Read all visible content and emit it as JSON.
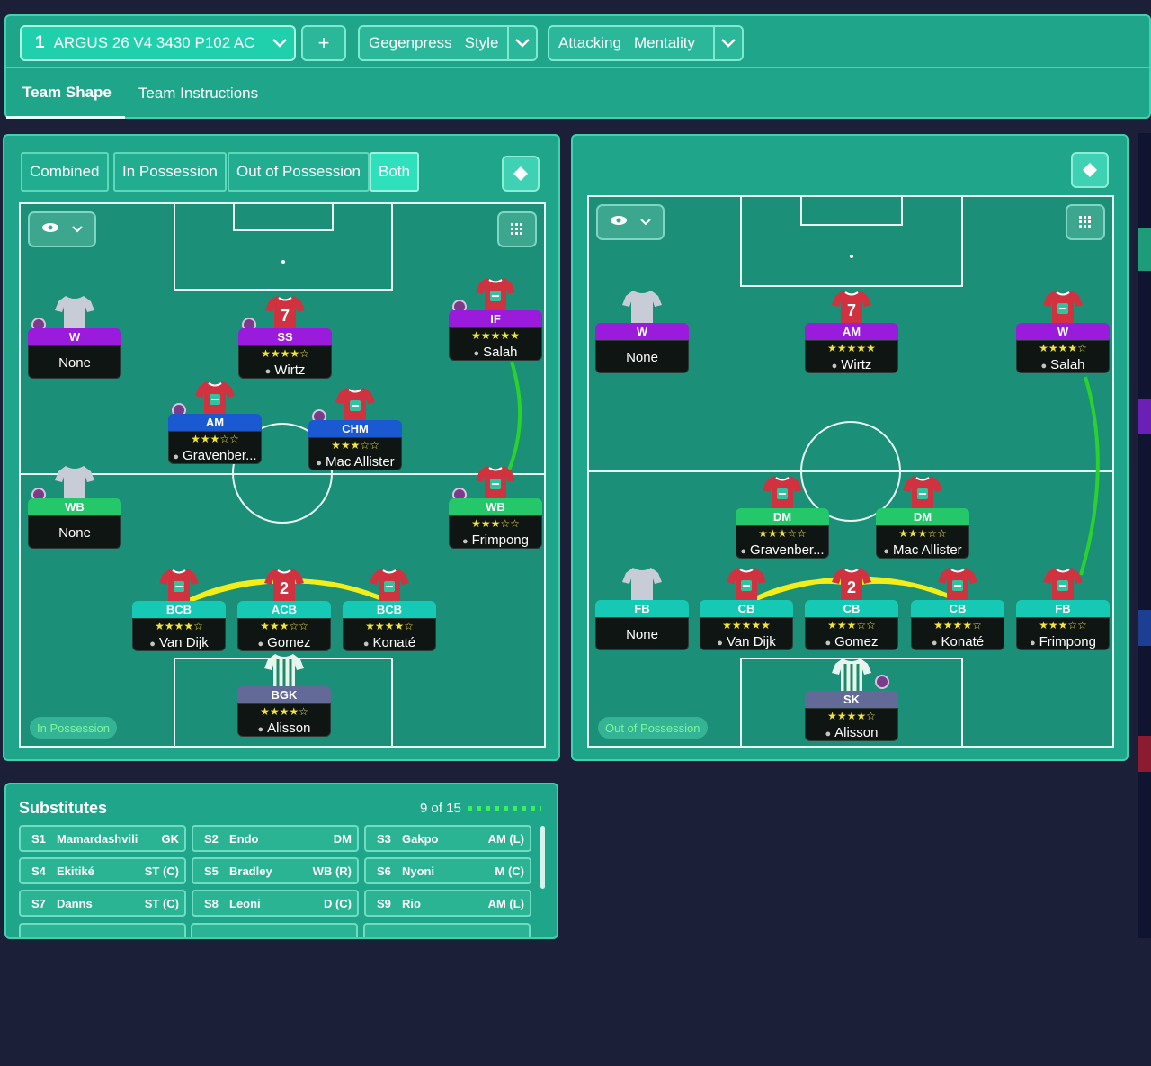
{
  "tactic": {
    "number": "1",
    "name": "ARGUS 26 V4 3430 P102 AC"
  },
  "add_label": "+",
  "style": {
    "w1": "Gegenpress",
    "w2": "Style"
  },
  "mentality": {
    "w1": "Attacking",
    "w2": "Mentality"
  },
  "tabs": [
    "Team Shape",
    "Team Instructions"
  ],
  "view_toggle": [
    "Combined",
    "In Possession",
    "Out of Possession",
    "Both"
  ],
  "pitch_left": {
    "label": "In Possession"
  },
  "pitch_right": {
    "label": "Out of Possession"
  },
  "colors": {
    "panel": "#1fa58a",
    "accent": "#2fe0bc",
    "link_green": "#2bd12f",
    "link_yellow": "#f3ee1a"
  },
  "left_players": [
    {
      "role": "W",
      "stars": "",
      "name": "None",
      "empty": true
    },
    {
      "role": "SS",
      "stars": "★★★★☆",
      "name": "Wirtz"
    },
    {
      "role": "IF",
      "stars": "★★★★★",
      "name": "Salah"
    },
    {
      "role": "AM",
      "stars": "★★★☆☆",
      "name": "Gravenber..."
    },
    {
      "role": "CHM",
      "stars": "★★★☆☆",
      "name": "Mac Allister"
    },
    {
      "role": "WB",
      "stars": "",
      "name": "None",
      "empty": true
    },
    {
      "role": "WB",
      "stars": "★★★☆☆",
      "name": "Frimpong"
    },
    {
      "role": "BCB",
      "stars": "★★★★☆",
      "name": "Van Dijk"
    },
    {
      "role": "ACB",
      "stars": "★★★☆☆",
      "name": "Gomez"
    },
    {
      "role": "BCB",
      "stars": "★★★★☆",
      "name": "Konaté"
    },
    {
      "role": "BGK",
      "stars": "★★★★☆",
      "name": "Alisson"
    }
  ],
  "right_players": [
    {
      "role": "W",
      "stars": "",
      "name": "None",
      "empty": true
    },
    {
      "role": "AM",
      "stars": "★★★★★",
      "name": "Wirtz"
    },
    {
      "role": "W",
      "stars": "★★★★☆",
      "name": "Salah"
    },
    {
      "role": "DM",
      "stars": "★★★☆☆",
      "name": "Gravenber..."
    },
    {
      "role": "DM",
      "stars": "★★★☆☆",
      "name": "Mac Allister"
    },
    {
      "role": "FB",
      "stars": "",
      "name": "None",
      "empty": true
    },
    {
      "role": "CB",
      "stars": "★★★★★",
      "name": "Van Dijk"
    },
    {
      "role": "CB",
      "stars": "★★★☆☆",
      "name": "Gomez"
    },
    {
      "role": "CB",
      "stars": "★★★★☆",
      "name": "Konaté"
    },
    {
      "role": "FB",
      "stars": "★★★☆☆",
      "name": "Frimpong"
    },
    {
      "role": "SK",
      "stars": "★★★★☆",
      "name": "Alisson"
    }
  ],
  "substitutes": {
    "title": "Substitutes",
    "count": "9 of 15",
    "items": [
      {
        "slot": "S1",
        "name": "Mamardashvili",
        "pos": "GK"
      },
      {
        "slot": "S2",
        "name": "Endo",
        "pos": "DM"
      },
      {
        "slot": "S3",
        "name": "Gakpo",
        "pos": "AM (L)"
      },
      {
        "slot": "S4",
        "name": "Ekitiké",
        "pos": "ST (C)"
      },
      {
        "slot": "S5",
        "name": "Bradley",
        "pos": "WB (R)"
      },
      {
        "slot": "S6",
        "name": "Nyoni",
        "pos": "M (C)"
      },
      {
        "slot": "S7",
        "name": "Danns",
        "pos": "ST (C)"
      },
      {
        "slot": "S8",
        "name": "Leoni",
        "pos": "D (C)"
      },
      {
        "slot": "S9",
        "name": "Rio",
        "pos": "AM (L)"
      }
    ]
  },
  "shirt_number_a": "7",
  "shirt_number_b": "2"
}
